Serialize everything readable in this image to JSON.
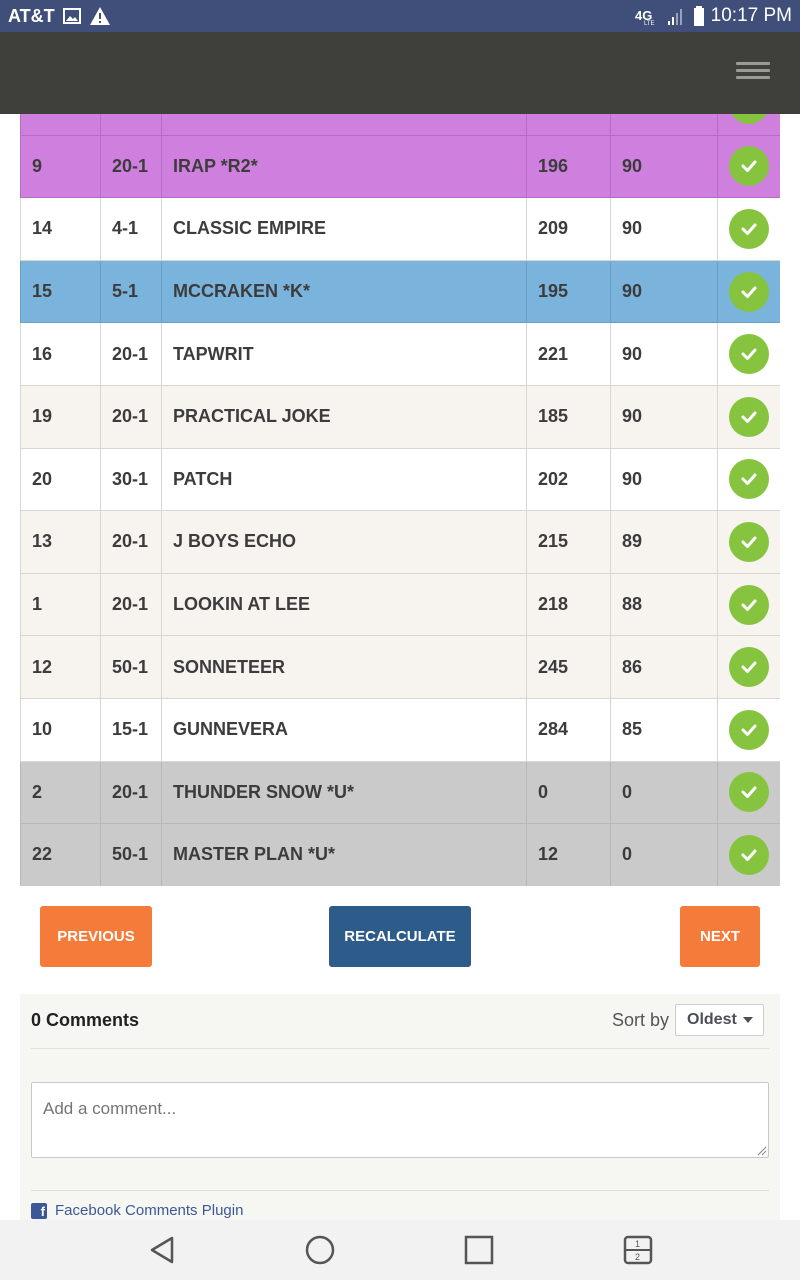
{
  "status_bar": {
    "carrier": "AT&T",
    "network": "4G LTE",
    "time": "10:17 PM",
    "icons": [
      "image-icon",
      "warning-icon",
      "lte-icon",
      "signal-icon",
      "battery-icon"
    ]
  },
  "header": {
    "menu_icon": "hamburger-menu-icon"
  },
  "table": {
    "rows": [
      {
        "style": "purple",
        "cells": [
          "",
          "",
          "",
          "",
          ""
        ],
        "check": true
      },
      {
        "style": "purple",
        "cells": [
          "9",
          "20-1",
          "IRAP *R2*",
          "196",
          "90"
        ],
        "check": true
      },
      {
        "style": "white",
        "cells": [
          "14",
          "4-1",
          "CLASSIC EMPIRE",
          "209",
          "90"
        ],
        "check": true
      },
      {
        "style": "blue",
        "cells": [
          "15",
          "5-1",
          "MCCRAKEN *K*",
          "195",
          "90"
        ],
        "check": true
      },
      {
        "style": "white",
        "cells": [
          "16",
          "20-1",
          "TAPWRIT",
          "221",
          "90"
        ],
        "check": true
      },
      {
        "style": "beige",
        "cells": [
          "19",
          "20-1",
          "PRACTICAL JOKE",
          "185",
          "90"
        ],
        "check": true
      },
      {
        "style": "white",
        "cells": [
          "20",
          "30-1",
          "PATCH",
          "202",
          "90"
        ],
        "check": true
      },
      {
        "style": "beige",
        "cells": [
          "13",
          "20-1",
          "J BOYS ECHO",
          "215",
          "89"
        ],
        "check": true
      },
      {
        "style": "beige",
        "cells": [
          "1",
          "20-1",
          "LOOKIN AT LEE",
          "218",
          "88"
        ],
        "check": true
      },
      {
        "style": "beige",
        "cells": [
          "12",
          "50-1",
          "SONNETEER",
          "245",
          "86"
        ],
        "check": true
      },
      {
        "style": "white",
        "cells": [
          "10",
          "15-1",
          "GUNNEVERA",
          "284",
          "85"
        ],
        "check": true
      },
      {
        "style": "gray",
        "cells": [
          "2",
          "20-1",
          "THUNDER SNOW *U*",
          "0",
          "0"
        ],
        "check": true
      },
      {
        "style": "gray",
        "cells": [
          "22",
          "50-1",
          "MASTER PLAN *U*",
          "12",
          "0"
        ],
        "check": true
      }
    ]
  },
  "buttons": {
    "previous": "PREVIOUS",
    "recalculate": "RECALCULATE",
    "next": "NEXT"
  },
  "comments": {
    "count_label": "0 Comments",
    "sort_label": "Sort by",
    "sort_value": "Oldest",
    "input_placeholder": "Add a comment...",
    "plugin_label": "Facebook Comments Plugin"
  },
  "colors": {
    "purple_row": "#cf7fde",
    "blue_row": "#7ab3dc",
    "gray_row": "#cacaca",
    "check_green": "#86c440",
    "orange_button": "#f47b3a",
    "blue_button": "#2d5b8a"
  }
}
